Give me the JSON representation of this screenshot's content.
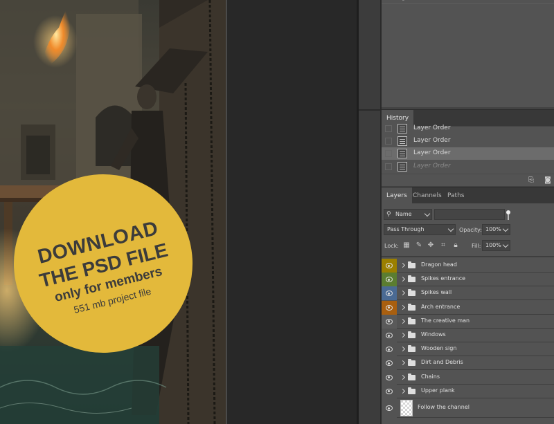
{
  "colors": {
    "stamp": "#e3b93b",
    "panel_bg": "#535353",
    "layer_yellow": "#9b7f00",
    "layer_green": "#5b7d30",
    "layer_blue": "#4a6a93",
    "layer_orange": "#a95f0f",
    "layer_gray": "#5a5a5a",
    "layer_none": "#535353"
  },
  "canvas": {
    "stamp": {
      "line1": "DOWNLOAD",
      "line2": "THE PSD FILE",
      "line3": "only for members",
      "line4": "551 mb project file"
    }
  },
  "history": {
    "tab": "History",
    "items": [
      {
        "label": "Layer Order",
        "state": "partial"
      },
      {
        "label": "Layer Order",
        "state": "normal"
      },
      {
        "label": "Layer Order",
        "state": "selected"
      },
      {
        "label": "Layer Order",
        "state": "undone"
      }
    ]
  },
  "layers_panel": {
    "tabs": [
      "Layers",
      "Channels",
      "Paths"
    ],
    "filter_kind": "Name",
    "blend_mode": "Pass Through",
    "opacity_label": "Opacity:",
    "opacity_value": "100%",
    "lock_label": "Lock:",
    "fill_label": "Fill:",
    "fill_value": "100%",
    "layers": [
      {
        "name": "Dragon head",
        "color": "layer_yellow",
        "type": "group"
      },
      {
        "name": "Spikes entrance",
        "color": "layer_green",
        "type": "group"
      },
      {
        "name": "Spikes wall",
        "color": "layer_blue",
        "type": "group"
      },
      {
        "name": "Arch entrance",
        "color": "layer_orange",
        "type": "group"
      },
      {
        "name": "The creative man",
        "color": "layer_gray",
        "type": "group"
      },
      {
        "name": "Windows",
        "color": "layer_none",
        "type": "group"
      },
      {
        "name": "Wooden sign",
        "color": "layer_none",
        "type": "group"
      },
      {
        "name": "Dirt and Debris",
        "color": "layer_none",
        "type": "group"
      },
      {
        "name": "Chains",
        "color": "layer_none",
        "type": "group"
      },
      {
        "name": "Upper plank",
        "color": "layer_none",
        "type": "group"
      },
      {
        "name": "Follow the channel",
        "color": "layer_none",
        "type": "pixel"
      }
    ]
  },
  "icons": {
    "new_doc": "new-document-from-state-icon",
    "snapshot": "camera-icon",
    "search": "search-icon",
    "lock_transparent": "lock-transparent-pixels-icon",
    "lock_image": "brush-icon",
    "lock_position": "move-icon",
    "lock_artboard": "artboard-icon",
    "lock_all": "lock-icon",
    "eye": "eye-icon",
    "folder": "folder-icon"
  }
}
